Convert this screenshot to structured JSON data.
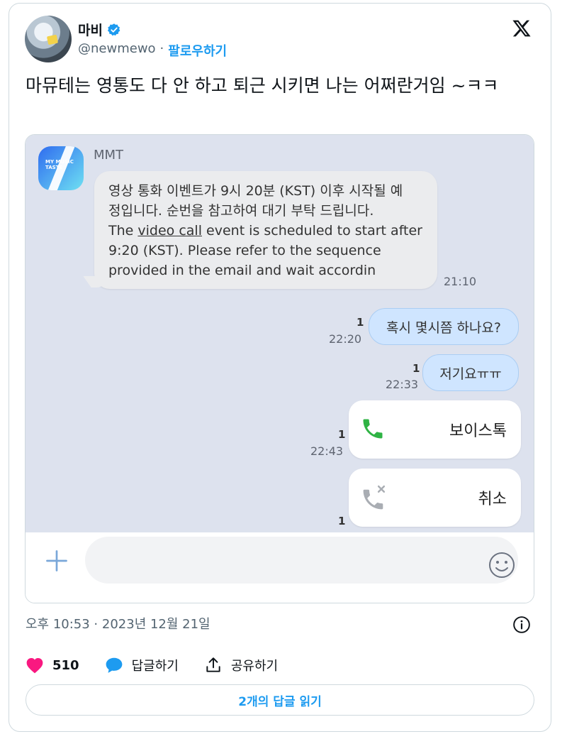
{
  "author": {
    "name": "마비",
    "handle": "@newmewo",
    "separator": "·",
    "follow_label": "팔로우하기"
  },
  "tweet": {
    "text": "마뮤테는 영통도 다 안 하고 퇴근 시키면 나는 어쩌란거임 ~ㅋㅋ"
  },
  "chat": {
    "sender": "MMT",
    "bot_logo_text": "MY MUSIC TASTE",
    "incoming": {
      "line1": "영상 통화 이벤트가 9시 20분 (KST) 이후 시작될 예",
      "line2": "정입니다. 순번을 참고하여 대기 부탁 드립니다.",
      "line3_pre": "The ",
      "line3_link": "video call",
      "line3_post": " event is scheduled to start after",
      "line4": "9:20 (KST). Please refer to the sequence",
      "line5": "provided in the email and wait accordin",
      "time": "21:10"
    },
    "outgoing": [
      {
        "text": "혹시 몇시쯤 하나요?",
        "time": "22:20",
        "unread": "1"
      },
      {
        "text": "저기요ㅠㅠ",
        "time": "22:33",
        "unread": "1"
      }
    ],
    "calls": [
      {
        "label": "보이스톡",
        "time": "22:43",
        "unread": "1",
        "icon": "phone-icon"
      },
      {
        "label": "취소",
        "unread": "1",
        "icon": "phone-cancelled-icon"
      }
    ],
    "input": {
      "plus_icon": "plus-icon",
      "emoji_icon": "emoji-icon",
      "hash_symbol": "#"
    }
  },
  "meta": {
    "timestamp": "오후 10:53 · 2023년 12월 21일"
  },
  "actions": {
    "like_count": "510",
    "reply_label": "답글하기",
    "share_label": "공유하기"
  },
  "read_replies_label": "2개의 답글 읽기",
  "colors": {
    "accent": "#1d9bf0",
    "like": "#f91880",
    "chat_bg": "#dde2ee",
    "bubble_out": "#cfe5ff"
  }
}
